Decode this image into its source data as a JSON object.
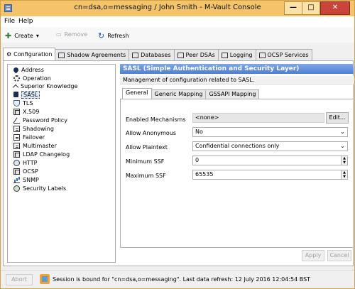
{
  "window": {
    "title": "cn=dsa,o=messaging / John Smith - M-Vault Console",
    "minimize_glyph": "—",
    "maximize_glyph": "□",
    "close_glyph": "✕"
  },
  "menu": [
    "File",
    "Help"
  ],
  "toolbar": {
    "create_label": "Create",
    "create_arrow": "▾",
    "remove_label": "Remove",
    "refresh_label": "Refresh"
  },
  "tabs": [
    {
      "label": "Configuration",
      "icon": "gear-icon"
    },
    {
      "label": "Shadow Agreements",
      "icon": "shadow-icon"
    },
    {
      "label": "Databases",
      "icon": "database-icon"
    },
    {
      "label": "Peer DSAs",
      "icon": "monitor-icon"
    },
    {
      "label": "Logging",
      "icon": "list-icon"
    },
    {
      "label": "OCSP Services",
      "icon": "ocsp-icon"
    }
  ],
  "tree": [
    {
      "label": "Address",
      "icon": "pin"
    },
    {
      "label": "Operation",
      "icon": "gear"
    },
    {
      "label": "Superior Knowledge",
      "icon": "up"
    },
    {
      "label": "SASL",
      "icon": "lock",
      "selected": true
    },
    {
      "label": "TLS",
      "icon": "shield"
    },
    {
      "label": "X.509",
      "icon": "cert"
    },
    {
      "label": "Password Policy",
      "icon": "pen"
    },
    {
      "label": "Shadowing",
      "icon": "page"
    },
    {
      "label": "Failover",
      "icon": "page"
    },
    {
      "label": "Multimaster",
      "icon": "page"
    },
    {
      "label": "LDAP Changelog",
      "icon": "cert"
    },
    {
      "label": "HTTP",
      "icon": "globe"
    },
    {
      "label": "OCSP",
      "icon": "cert"
    },
    {
      "label": "SNMP",
      "icon": "bars"
    },
    {
      "label": "Security Labels",
      "icon": "badge"
    }
  ],
  "panel": {
    "header": "SASL (Simple Authentication and Security Layer)",
    "description": "Management of configuration related to SASL.",
    "subtabs": [
      "General",
      "Generic Mapping",
      "GSSAPI Mapping"
    ],
    "fields": {
      "enabled_mechanisms_label": "Enabled Mechanisms",
      "enabled_mechanisms_value": "<none>",
      "edit_button": "Edit...",
      "allow_anonymous_label": "Allow Anonymous",
      "allow_anonymous_value": "No",
      "allow_plaintext_label": "Allow Plaintext",
      "allow_plaintext_value": "Confidential connections only",
      "min_ssf_label": "Minimum SSF",
      "min_ssf_value": "0",
      "max_ssf_label": "Maximum SSF",
      "max_ssf_value": "65535"
    },
    "apply_button": "Apply",
    "cancel_button": "Cancel"
  },
  "status": {
    "abort_button": "Abort",
    "text": "Session is bound for \"cn=dsa,o=messaging\". Last data refresh: 12 July 2016 12:04:54 BST"
  },
  "colors": {
    "titlebar": "#f4c46a",
    "panel_header": "#4f7fd4",
    "close_button": "#c9453a"
  }
}
